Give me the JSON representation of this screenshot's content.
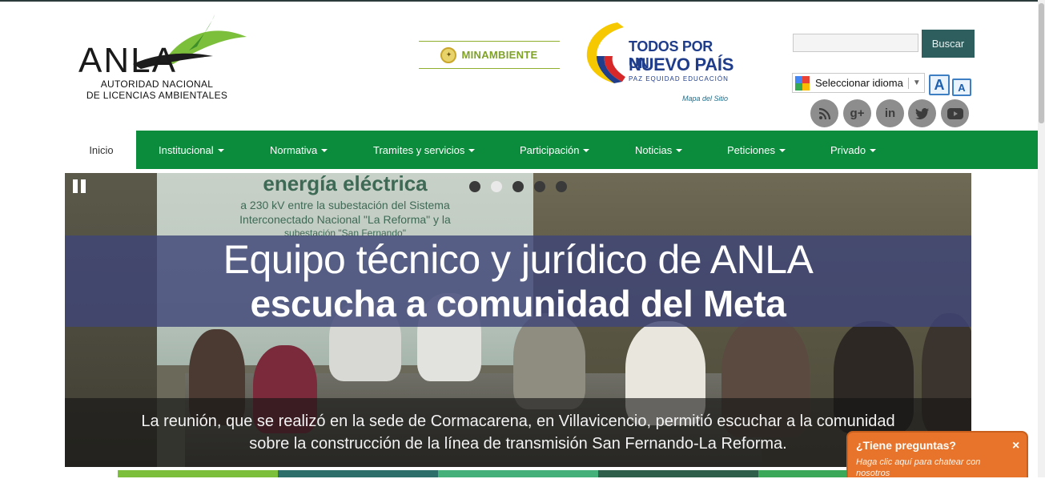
{
  "header": {
    "logo": {
      "wordmark": "ANLA",
      "subtitle_line1": "AUTORIDAD NACIONAL",
      "subtitle_line2": "DE LICENCIAS  AMBIENTALES"
    },
    "minambiente": "MINAMBIENTE",
    "todos_por_un_pais": {
      "line1": "TODOS POR UN",
      "line2": "NUEVO PAÍS",
      "line3": "PAZ  EQUIDAD  EDUCACIÓN"
    },
    "mapa_del_sitio": "Mapa del Sitio",
    "search": {
      "value": "",
      "placeholder": "",
      "button_label": "Buscar"
    },
    "translate": {
      "label": "Seleccionar idioma",
      "arrow": "▼"
    },
    "font_controls": {
      "increase": "A",
      "decrease": "A"
    },
    "social": [
      {
        "name": "rss-icon",
        "glyph": "◉"
      },
      {
        "name": "google-plus-icon",
        "glyph": "g+"
      },
      {
        "name": "linkedin-icon",
        "glyph": "in"
      },
      {
        "name": "twitter-icon",
        "glyph": "🐦"
      },
      {
        "name": "youtube-icon",
        "glyph": "▶"
      }
    ]
  },
  "nav": {
    "items": [
      {
        "label": "Inicio",
        "dropdown": false,
        "active": true
      },
      {
        "label": "Institucional",
        "dropdown": true
      },
      {
        "label": "Normativa",
        "dropdown": true
      },
      {
        "label": "Tramites y servicios",
        "dropdown": true
      },
      {
        "label": "Participación",
        "dropdown": true
      },
      {
        "label": "Noticias",
        "dropdown": true
      },
      {
        "label": "Peticiones",
        "dropdown": true
      },
      {
        "label": "Privado",
        "dropdown": true
      }
    ]
  },
  "slider": {
    "board_text": {
      "line1": "energía eléctrica",
      "line2": "a 230 kV entre la subestación del Sistema",
      "line3": "Interconectado Nacional \"La Reforma\" y la",
      "line4": "subestación \"San Fernando\""
    },
    "headline_line1": "Equipo técnico y jurídico de ANLA",
    "headline_line2": "escucha a comunidad del Meta",
    "caption_line1": "La reunión, que se realizó en la sede de Cormacarena, en Villavicencio, permitió escuchar a la comunidad",
    "caption_line2": "sobre la construcción de la línea de transmisión San Fernando-La Reforma.",
    "slide_count": 5,
    "active_slide": 2
  },
  "chat": {
    "title": "¿Tiene preguntas?",
    "subtitle": "Haga clic aquí para chatear con nosotros",
    "close": "×"
  },
  "colors": {
    "nav_green": "#0b8c3c",
    "search_button": "#2e5e5e",
    "chat_orange": "#e7742a",
    "headline_band": "#40467a"
  }
}
